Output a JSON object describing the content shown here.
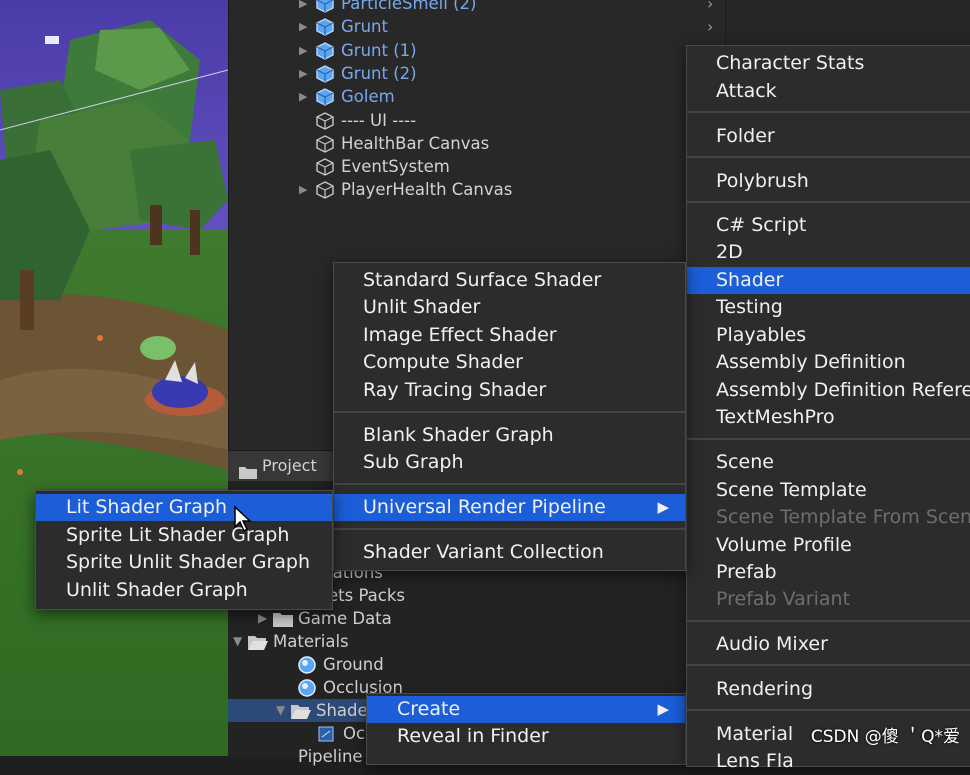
{
  "hierarchy": {
    "rows": [
      {
        "label": "ParticleSmell (2)",
        "expandable": true,
        "prefab": true
      },
      {
        "label": "Grunt",
        "expandable": true,
        "prefab": true
      },
      {
        "label": "Grunt (1)",
        "expandable": true,
        "prefab": true
      },
      {
        "label": "Grunt (2)",
        "expandable": true,
        "prefab": true
      },
      {
        "label": "Golem",
        "expandable": true,
        "prefab": true
      },
      {
        "label": "---- UI ----",
        "expandable": false,
        "prefab": false
      },
      {
        "label": "HealthBar Canvas",
        "expandable": false,
        "prefab": false
      },
      {
        "label": "EventSystem",
        "expandable": false,
        "prefab": false
      },
      {
        "label": "PlayerHealth Canvas",
        "expandable": true,
        "prefab": false
      }
    ]
  },
  "project": {
    "tab_label": "Project",
    "rows": [
      {
        "label": "lations",
        "type": "partial"
      },
      {
        "label": "ets Packs",
        "type": "partial"
      },
      {
        "label": "Game Data",
        "type": "folder"
      },
      {
        "label": "Materials",
        "type": "folder-open"
      },
      {
        "label": "Ground",
        "type": "material"
      },
      {
        "label": "Occlusion",
        "type": "material"
      },
      {
        "label": "Shade",
        "type": "folder-open-selected"
      },
      {
        "label": "Occ",
        "type": "asset"
      },
      {
        "label": "Pipeline",
        "type": "partial"
      }
    ]
  },
  "create_menu": {
    "items": [
      {
        "label": "Character Stats"
      },
      {
        "label": "Attack"
      },
      {
        "label": "Folder"
      },
      {
        "label": "Polybrush"
      },
      {
        "label": "C# Script"
      },
      {
        "label": "2D"
      },
      {
        "label": "Shader",
        "selected": true
      },
      {
        "label": "Testing"
      },
      {
        "label": "Playables"
      },
      {
        "label": "Assembly Definition"
      },
      {
        "label": "Assembly Definition Refere"
      },
      {
        "label": "TextMeshPro"
      },
      {
        "label": "Scene"
      },
      {
        "label": "Scene Template"
      },
      {
        "label": "Scene Template From Scen",
        "disabled": true
      },
      {
        "label": "Volume Profile"
      },
      {
        "label": "Prefab"
      },
      {
        "label": "Prefab Variant",
        "disabled": true
      },
      {
        "label": "Audio Mixer"
      },
      {
        "label": "Rendering"
      },
      {
        "label": "Material"
      },
      {
        "label": "Lens Fla"
      }
    ]
  },
  "shader_menu": {
    "items": [
      {
        "label": "Standard Surface Shader"
      },
      {
        "label": "Unlit Shader"
      },
      {
        "label": "Image Effect Shader"
      },
      {
        "label": "Compute Shader"
      },
      {
        "label": "Ray Tracing Shader"
      },
      {
        "label": "Blank Shader Graph"
      },
      {
        "label": "Sub Graph"
      },
      {
        "label": "Universal Render Pipeline",
        "selected": true,
        "submenu": true
      },
      {
        "label": "Shader Variant Collection"
      }
    ]
  },
  "urp_menu": {
    "items": [
      {
        "label": "Lit Shader Graph",
        "selected": true
      },
      {
        "label": "Sprite Lit Shader Graph"
      },
      {
        "label": "Sprite Unlit Shader Graph"
      },
      {
        "label": "Unlit Shader Graph"
      }
    ]
  },
  "asset_menu": {
    "items": [
      {
        "label": "Create",
        "selected": true,
        "submenu": true
      },
      {
        "label": "Reveal in Finder"
      }
    ]
  },
  "icons": {
    "submenu_arrow": "▶",
    "chevron_right": "›",
    "expand_arrow": "▶",
    "collapse_arrow": "▼"
  },
  "colors": {
    "selection": "#1b5ed8",
    "prefab_text": "#79a8ea",
    "menu_bg": "#2c2c2c"
  },
  "watermark": "CSDN @傻 ＇Q*爱"
}
